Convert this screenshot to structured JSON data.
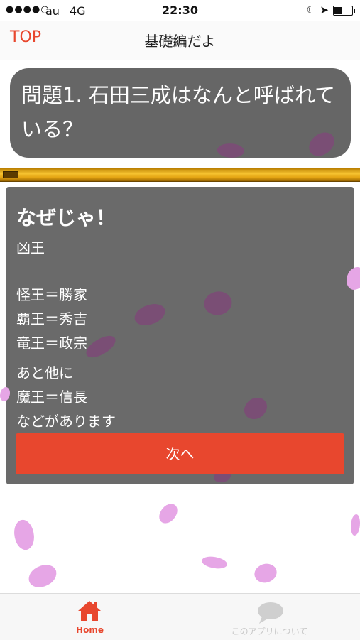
{
  "status_bar": {
    "signal": "●●●●○",
    "carrier": "au",
    "network": "4G",
    "time": "22:30",
    "moon_icon": "☾",
    "location_icon": "➤"
  },
  "nav": {
    "top_label": "TOP",
    "title": "基礎編だよ"
  },
  "question": {
    "text": "問題1. 石田三成はなんと呼ばれている？"
  },
  "progress": {
    "value_fraction": 0.04
  },
  "answer": {
    "heading": "なぜじゃ！",
    "lines": [
      "凶王",
      "",
      "怪王＝勝家",
      "覇王＝秀吉",
      "竜王＝政宗",
      "あと他に",
      "魔王＝信長",
      "などがあります"
    ],
    "next_button": "次へ"
  },
  "tabs": [
    {
      "label": "Home",
      "icon": "home-icon",
      "active": true
    },
    {
      "label": "このアプリについて",
      "icon": "speech-bubble-icon",
      "active": false
    }
  ],
  "colors": {
    "accent": "#e8472e",
    "card": "#666666",
    "petal_pink": "#e6a6e6"
  }
}
